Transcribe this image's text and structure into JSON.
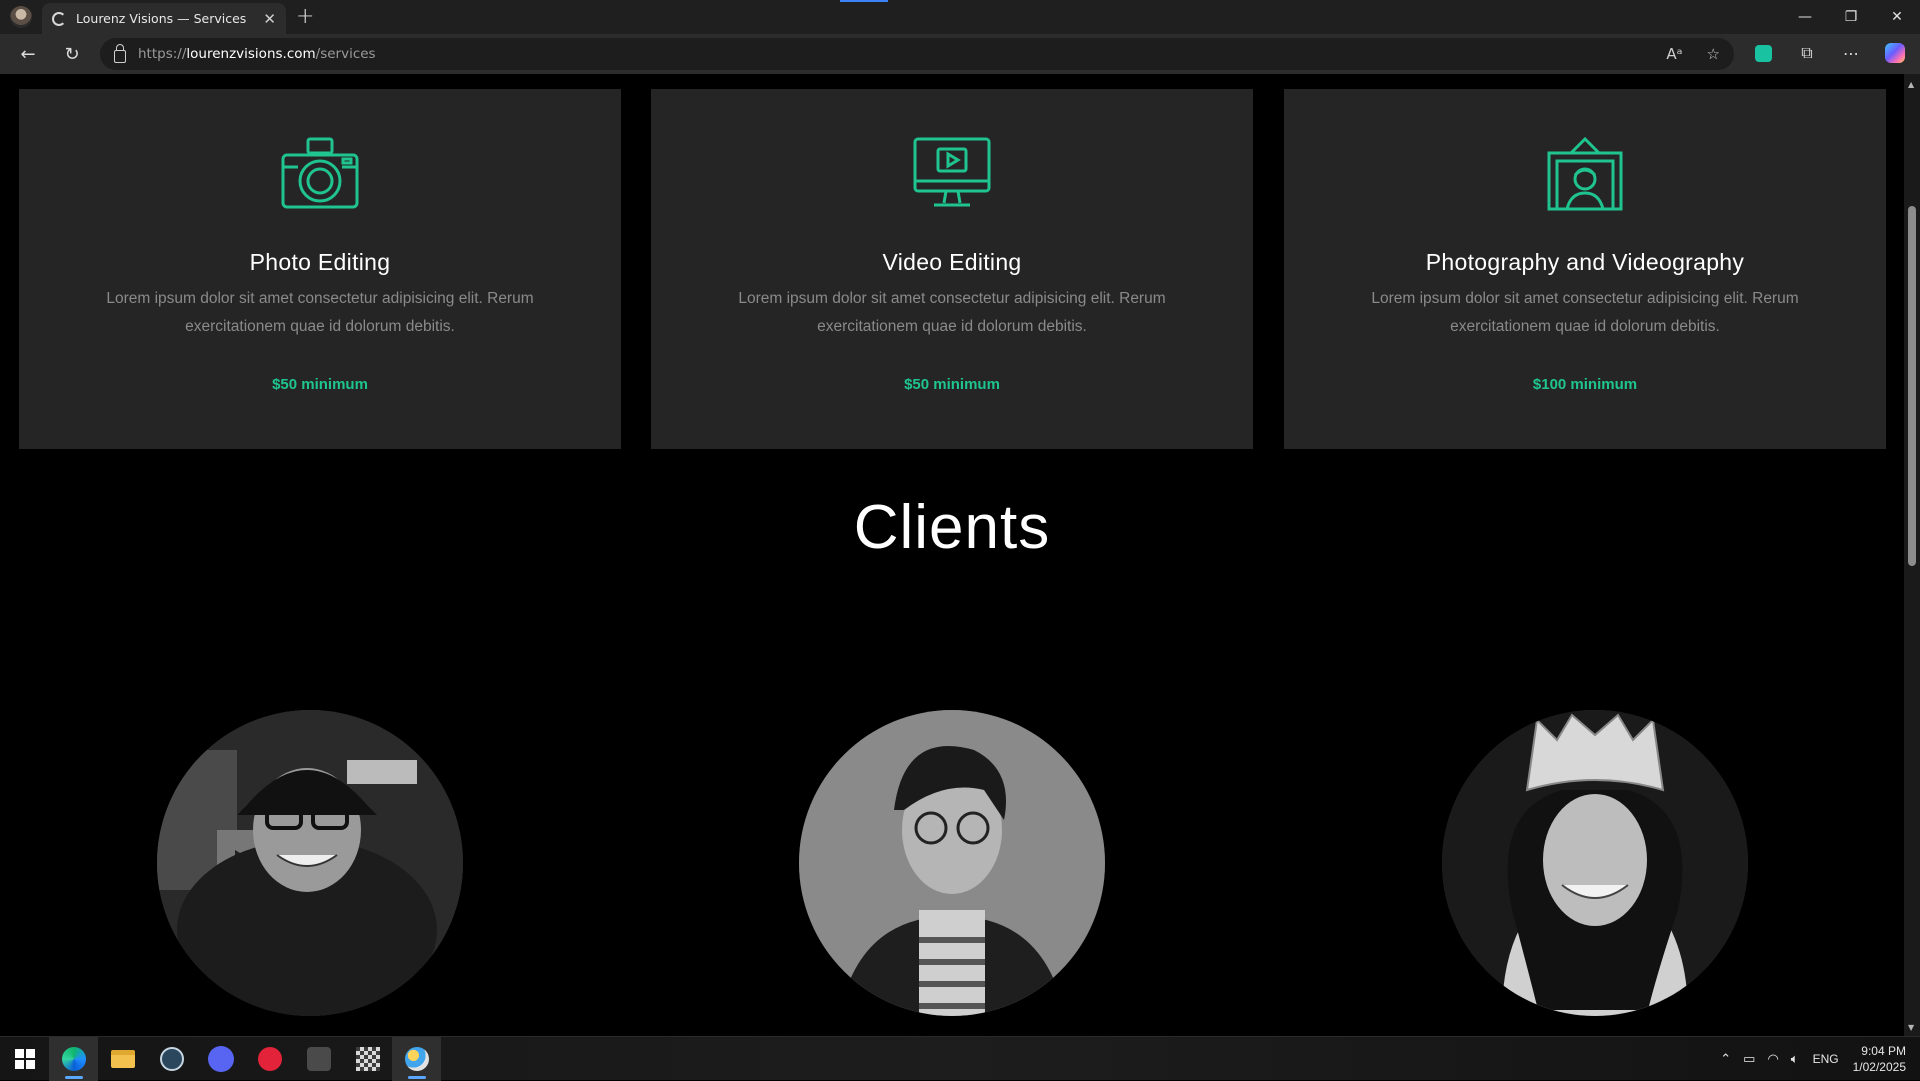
{
  "browser": {
    "tab_title": "Lourenz Visions — Services",
    "new_tab": "+",
    "url_prefix": "https://",
    "url_host": "lourenzvisions.com",
    "url_path": "/services",
    "window_controls": [
      "—",
      "❐",
      "✕"
    ]
  },
  "services": [
    {
      "icon": "camera-icon",
      "title": "Photo Editing",
      "description": "Lorem ipsum dolor sit amet consectetur adipisicing elit. Rerum exercitationem quae id dolorum debitis.",
      "price": "$50 minimum"
    },
    {
      "icon": "monitor-play-icon",
      "title": "Video Editing",
      "description": "Lorem ipsum dolor sit amet consectetur adipisicing elit. Rerum exercitationem quae id dolorum debitis.",
      "price": "$50 minimum"
    },
    {
      "icon": "framed-portrait-icon",
      "title": "Photography and Videography",
      "description": "Lorem ipsum dolor sit amet consectetur adipisicing elit. Rerum exercitationem quae id dolorum debitis.",
      "price": "$100 minimum"
    }
  ],
  "clients": {
    "heading": "Clients"
  },
  "taskbar": {
    "language": "ENG",
    "time": "9:04 PM",
    "date": "1/02/2025"
  },
  "colors": {
    "accent": "#1fc48f",
    "card_bg": "#252525",
    "page_bg": "#000000"
  }
}
